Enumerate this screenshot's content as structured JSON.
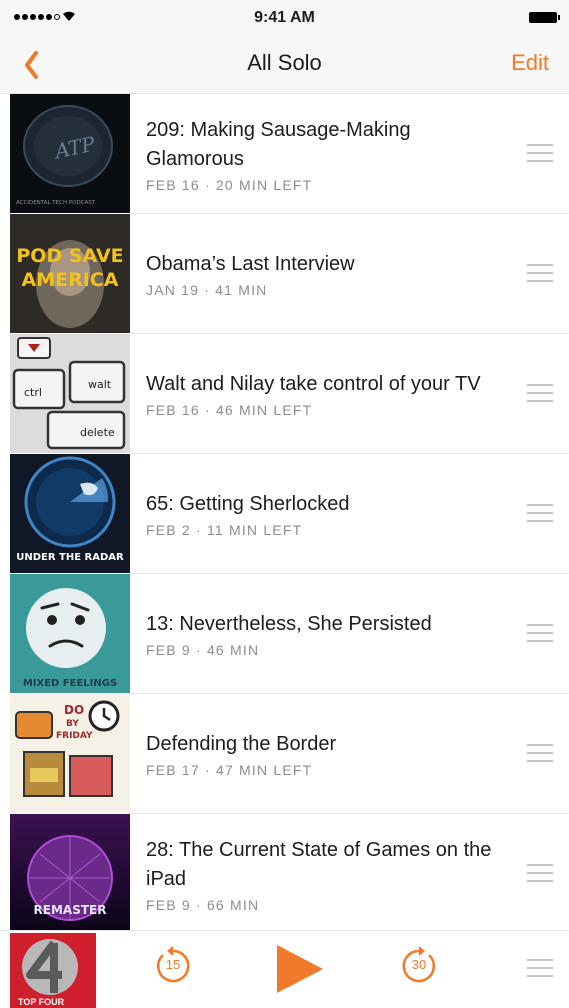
{
  "status_bar": {
    "time": "9:41 AM"
  },
  "nav": {
    "title": "All Solo",
    "edit_label": "Edit"
  },
  "episodes": [
    {
      "title": "209: Making Sausage-Making Glamorous",
      "meta": "FEB 16 · 20 MIN LEFT",
      "podcast": "Accidental Tech Podcast",
      "art_text": "ATP",
      "art_subtext": "ACCIDENTAL TECH PODCAST"
    },
    {
      "title": "Obama’s Last Interview",
      "meta": "JAN 19 · 41 MIN",
      "podcast": "Pod Save America",
      "art_text": "POD SAVE",
      "art_subtext": "AMERICA"
    },
    {
      "title": "Walt and Nilay take control of your TV",
      "meta": "FEB 16 · 46 MIN LEFT",
      "podcast": "Ctrl Walt Delete",
      "art_text": "ctrl",
      "art_subtext": "walt",
      "art_extra": "delete"
    },
    {
      "title": "65: Getting Sherlocked",
      "meta": "FEB 2 · 11 MIN LEFT",
      "podcast": "Under the Radar",
      "art_text": "UNDER THE RADAR"
    },
    {
      "title": "13: Nevertheless, She Persisted",
      "meta": "FEB 9 · 46 MIN",
      "podcast": "Mixed Feelings",
      "art_text": "MIXED FEELINGS"
    },
    {
      "title": "Defending the Border",
      "meta": "FEB 17 · 47 MIN LEFT",
      "podcast": "Do By Friday",
      "art_text": "DO",
      "art_subtext": "BY",
      "art_extra": "FRIDAY"
    },
    {
      "title": "28: The Current State of Games on the iPad",
      "meta": "FEB 9 · 66 MIN",
      "podcast": "Remaster",
      "art_text": "REMASTER"
    }
  ],
  "player": {
    "now_playing_art_label": "TOP FOUR",
    "skip_back": "15",
    "skip_forward": "30"
  },
  "colors": {
    "accent": "#f07a2a",
    "nav_bg": "#f7f7f7"
  }
}
